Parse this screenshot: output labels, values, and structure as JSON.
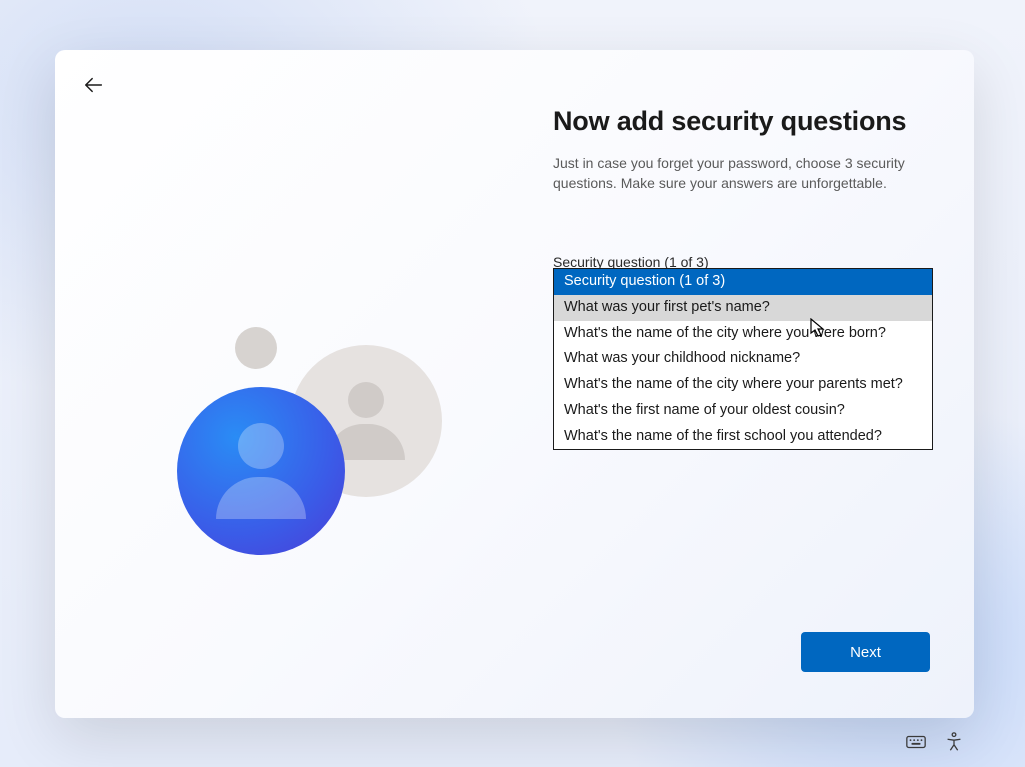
{
  "header": {
    "title": "Now add security questions",
    "subtitle": "Just in case you forget your password, choose 3 security questions. Make sure your answers are unforgettable."
  },
  "form": {
    "label": "Security question (1 of 3)",
    "options": [
      "Security question (1 of 3)",
      "What was your first pet's name?",
      "What's the name of the city where you were born?",
      "What was your childhood nickname?",
      "What's the name of the city where your parents met?",
      "What's the first name of your oldest cousin?",
      "What's the name of the first school you attended?"
    ],
    "selected_index": 0,
    "hovered_index": 1
  },
  "actions": {
    "next_label": "Next"
  }
}
